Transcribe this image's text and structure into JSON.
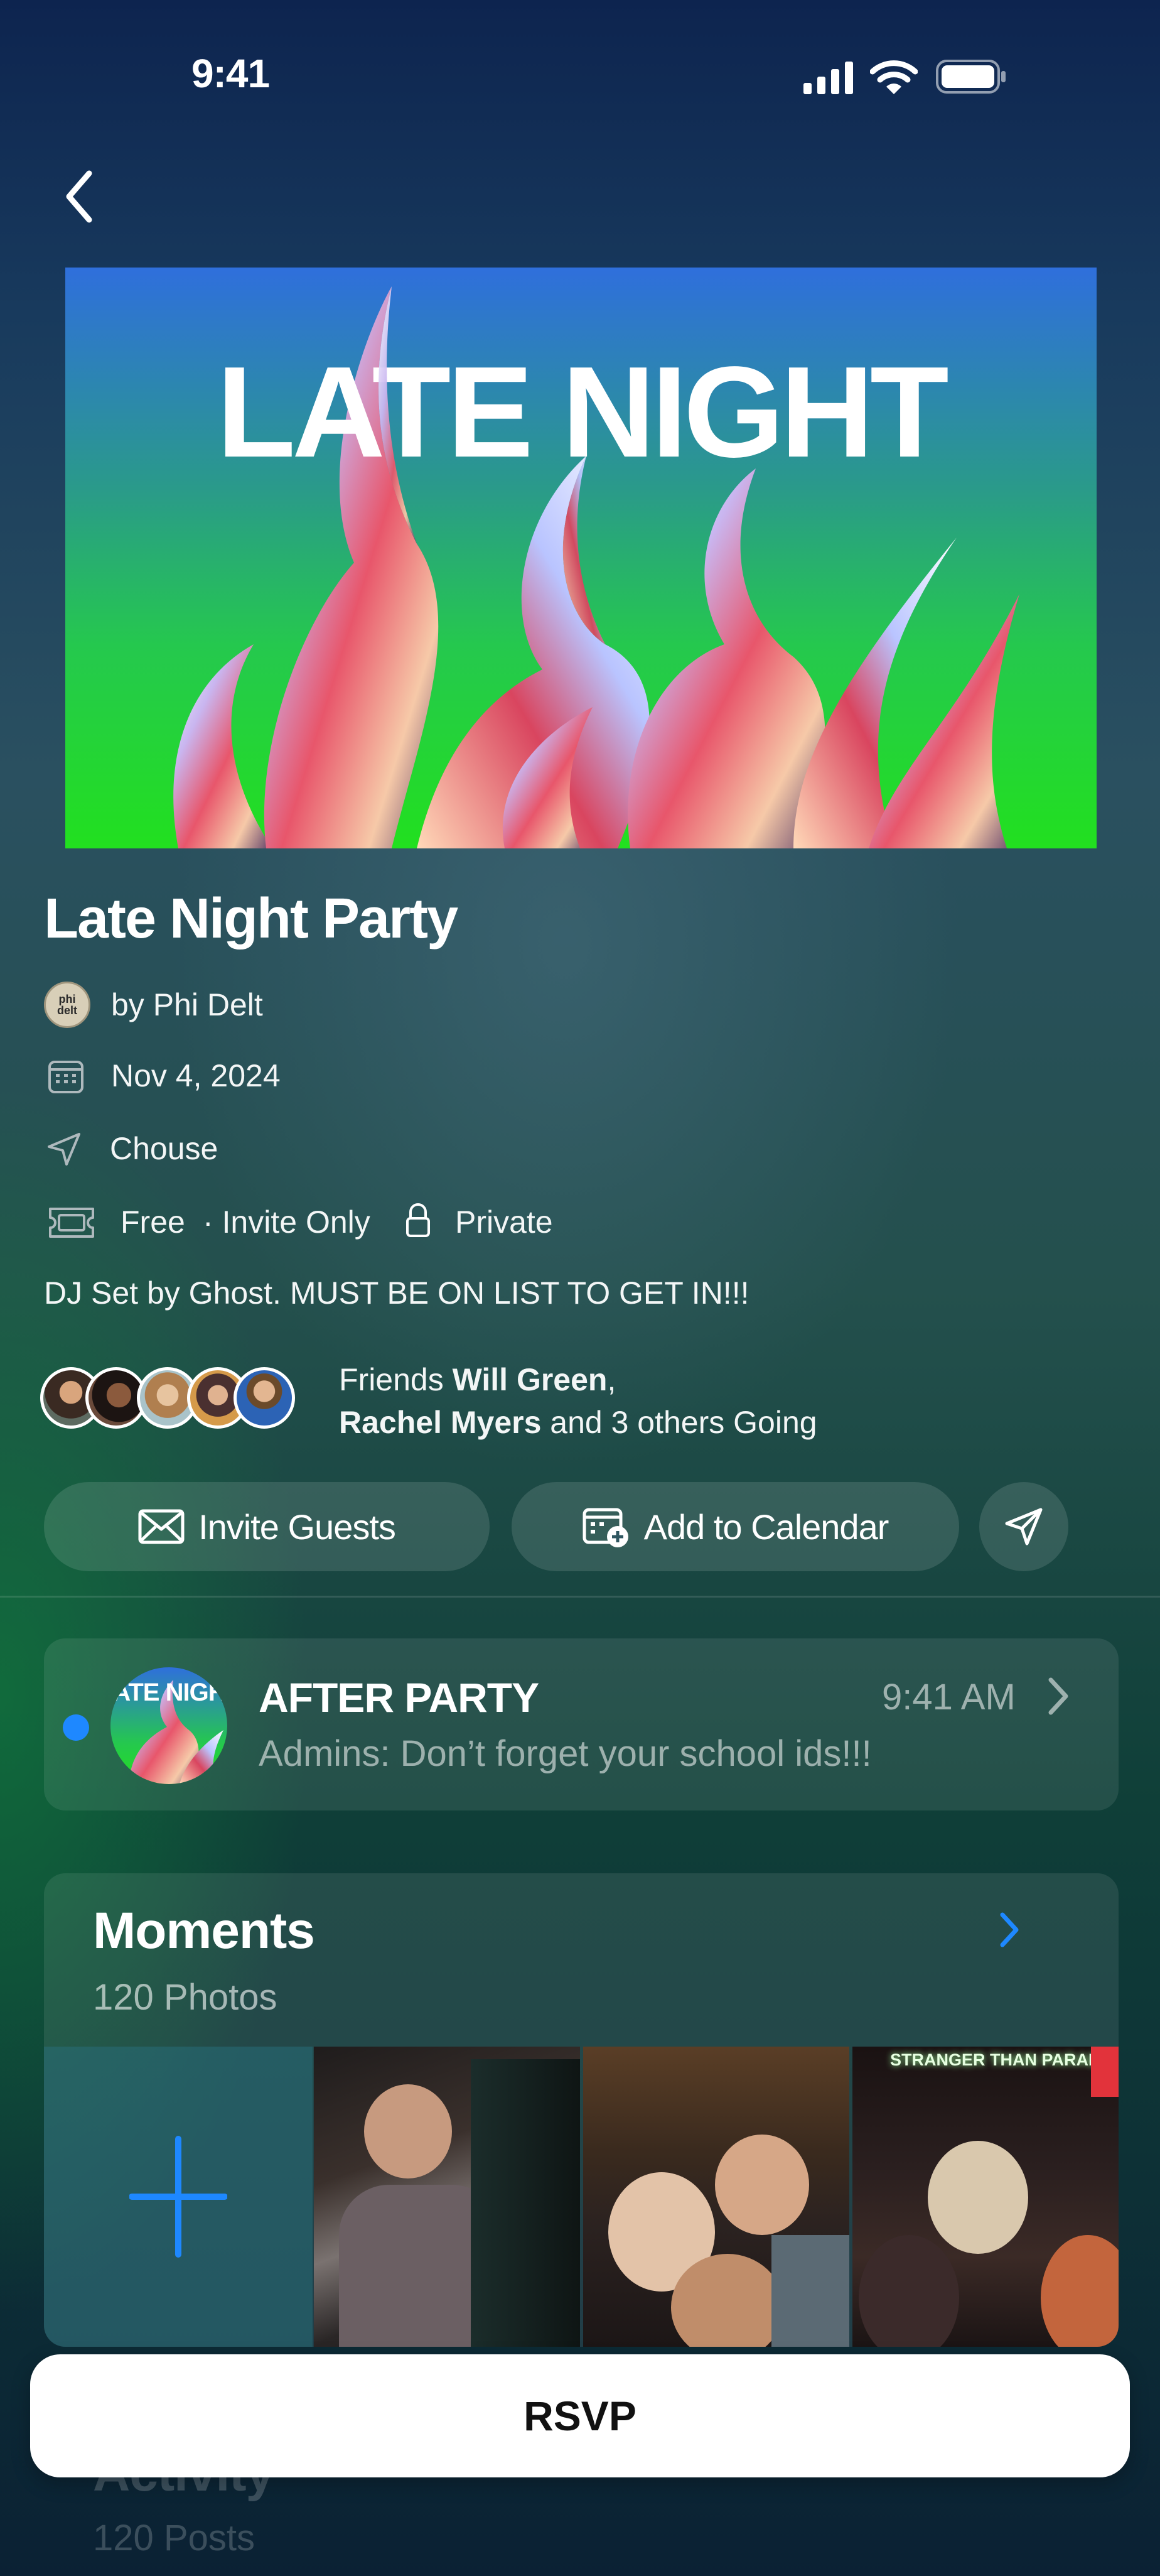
{
  "status_bar": {
    "time": "9:41"
  },
  "banner": {
    "title": "LATE NIGHT"
  },
  "event": {
    "title": "Late Night Party",
    "host_logo_text": "phi delt",
    "host": "by Phi Delt",
    "date": "Nov 4, 2024",
    "location": "Chouse",
    "price": "Free",
    "invite_type": "· Invite Only",
    "privacy": "Private",
    "description": "DJ Set by Ghost. MUST BE ON LIST TO GET IN!!!"
  },
  "friends": {
    "prefix": "Friends ",
    "name1": "Will Green",
    "comma": ",",
    "name2": "Rachel Myers",
    "suffix": " and 3 others Going"
  },
  "actions": {
    "invite_label": "Invite Guests",
    "calendar_label": "Add to Calendar"
  },
  "chat": {
    "thumb_text": "LATE NIGHT",
    "title": "AFTER PARTY",
    "time": "9:41 AM",
    "preview": "Admins: Don’t forget your school ids!!!"
  },
  "moments": {
    "title": "Moments",
    "count": "120 Photos",
    "photo3_sign": "STRANGER THAN PARADISE"
  },
  "activity": {
    "title": "Activity",
    "count": "120 Posts"
  },
  "rsvp": {
    "label": "RSVP"
  },
  "colors": {
    "accent_blue": "#1e88ff",
    "banner_top": "#2f6fdc",
    "banner_bottom": "#22e01f"
  }
}
